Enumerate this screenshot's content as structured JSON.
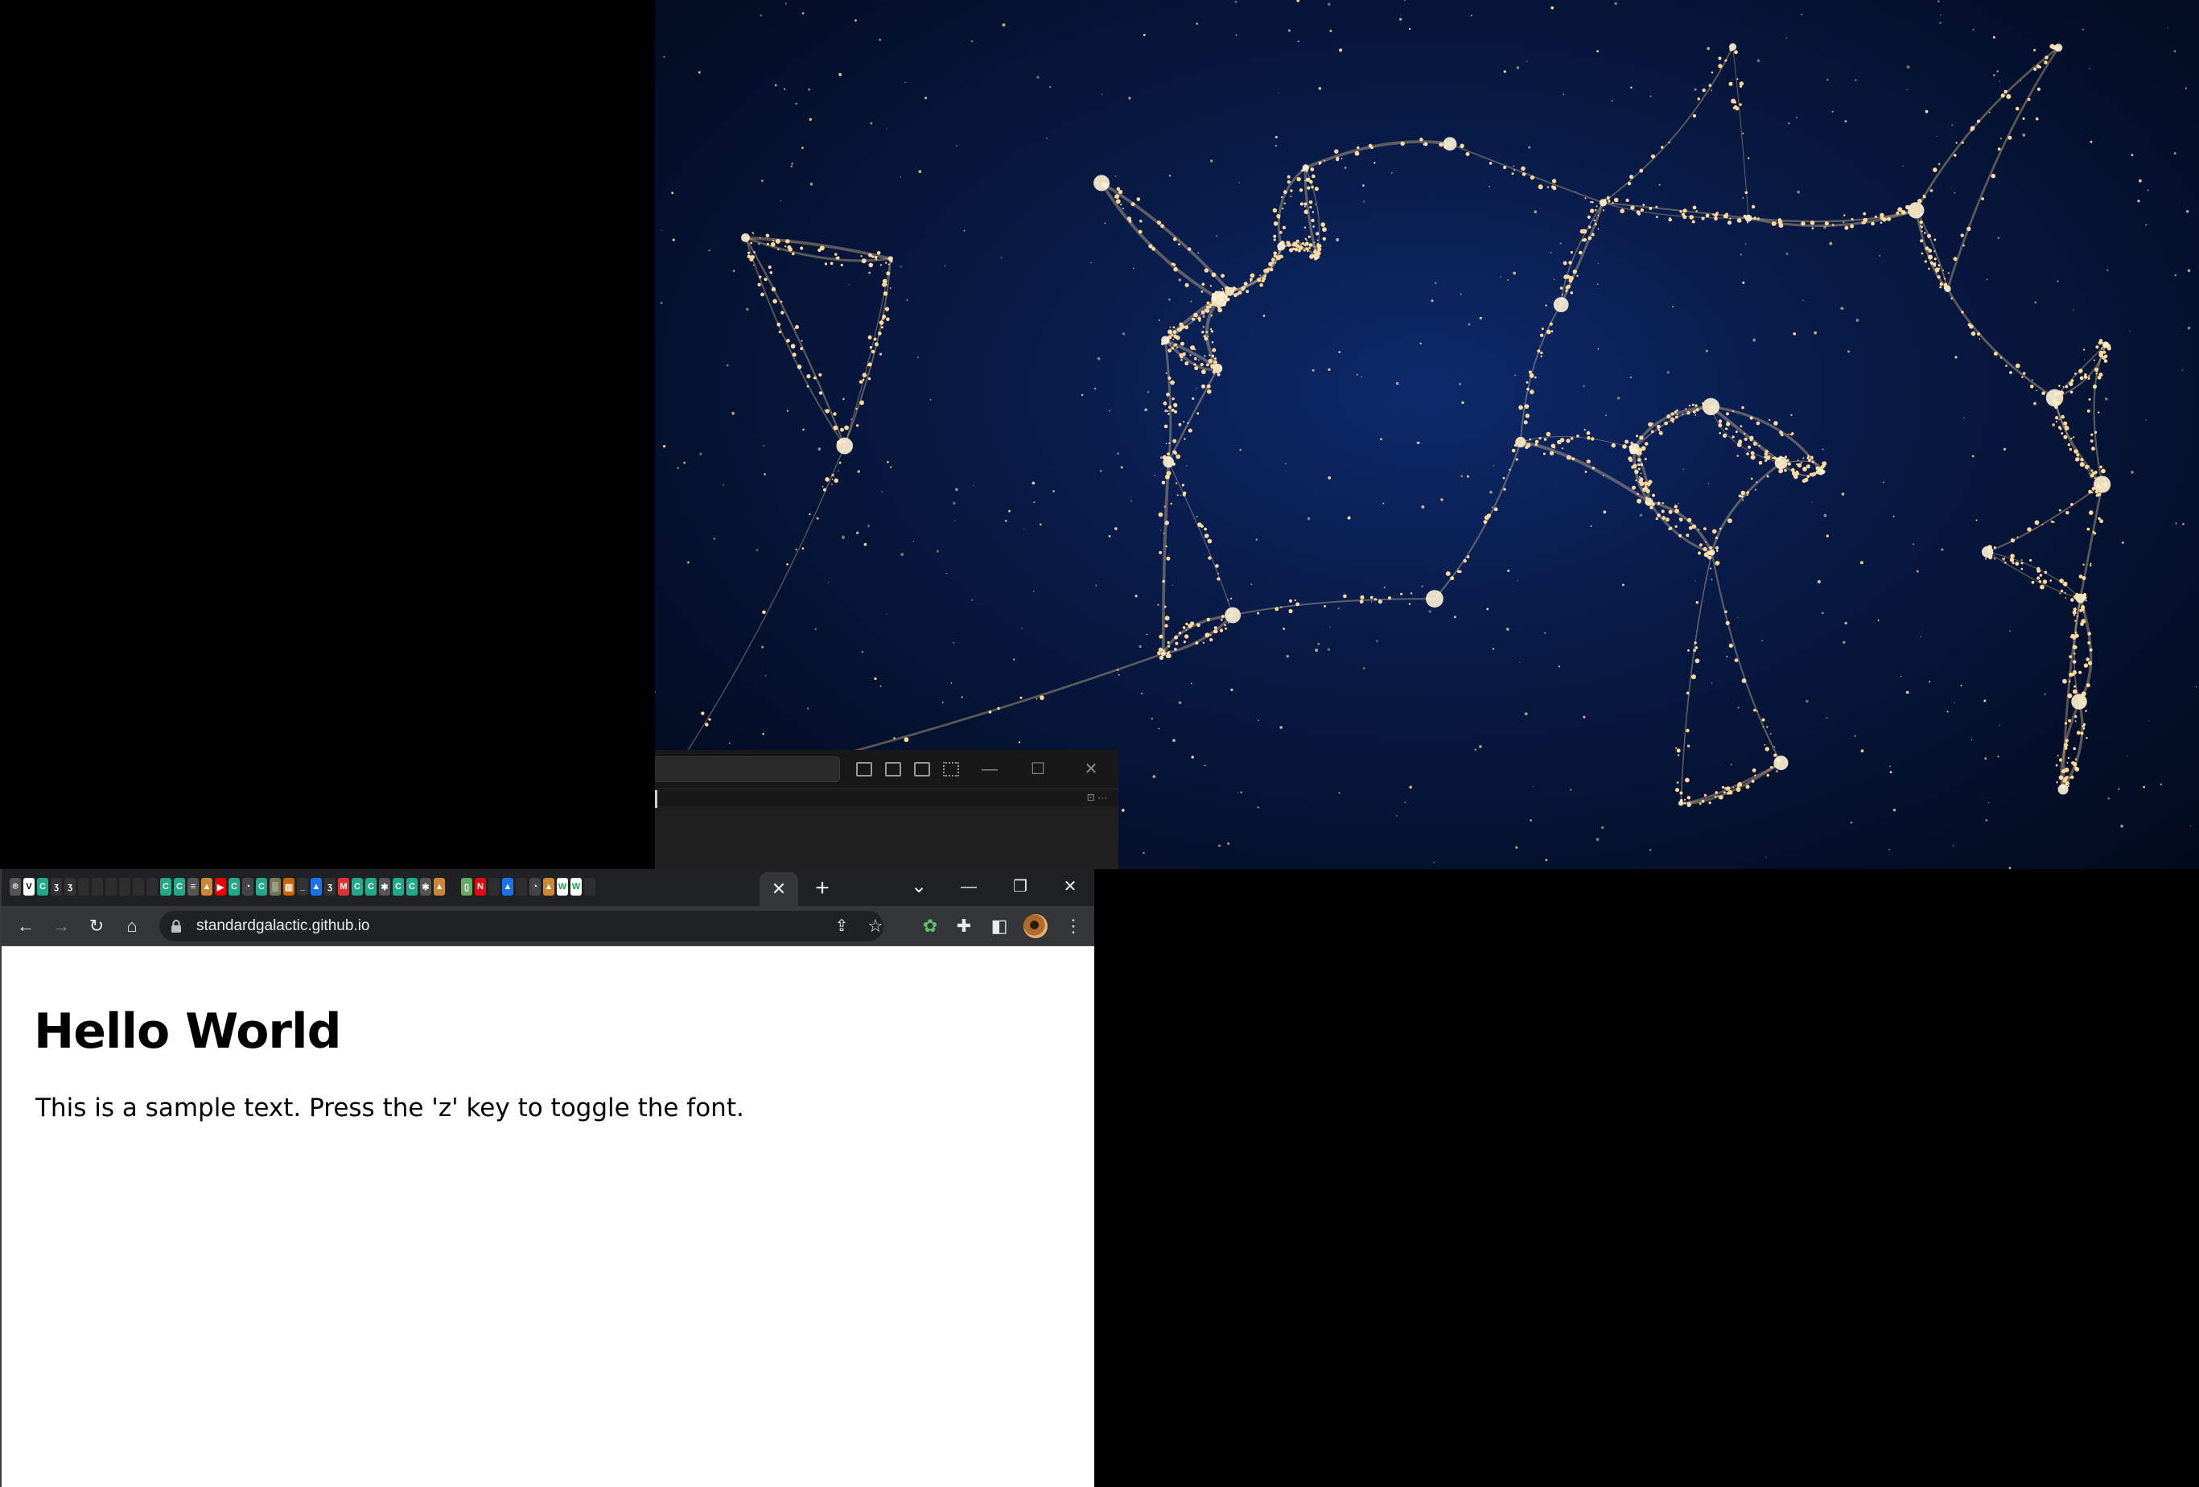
{
  "wallpaper": {
    "description_icon": "cosmic-web-wallpaper",
    "colors": {
      "void": "#04102c",
      "filament": "#ffd99a"
    }
  },
  "editor": {
    "layout_icons": [
      "toggle-primary-sidebar-icon",
      "toggle-panel-icon",
      "toggle-secondary-sidebar-icon",
      "customize-layout-icon"
    ],
    "window_controls": {
      "minimize": "—",
      "maximize": "☐",
      "close": "✕"
    },
    "mini_label": "⊡ ···"
  },
  "chrome": {
    "tabs": {
      "favicons": [
        {
          "glyph": "⌾",
          "bg": "#555"
        },
        {
          "glyph": "V",
          "bg": "#fff",
          "fg": "#000"
        },
        {
          "glyph": "C",
          "bg": "#2a8",
          "fg": "#fff"
        },
        {
          "glyph": "ʒ",
          "bg": "#333"
        },
        {
          "glyph": "ʒ",
          "bg": "#333"
        },
        {
          "glyph": "",
          "bg": "#2e2e2e"
        },
        {
          "glyph": "",
          "bg": "#2e2e2e"
        },
        {
          "glyph": "",
          "bg": "#2e2e2e"
        },
        {
          "glyph": "",
          "bg": "#2e2e2e"
        },
        {
          "glyph": "",
          "bg": "#2e2e2e"
        },
        {
          "glyph": "",
          "bg": "#2e2e2e"
        },
        {
          "glyph": "C",
          "bg": "#2a8"
        },
        {
          "glyph": "C",
          "bg": "#2a8"
        },
        {
          "glyph": "≡",
          "bg": "#555"
        },
        {
          "glyph": "▲",
          "bg": "#c83"
        },
        {
          "glyph": "▶",
          "bg": "#e00"
        },
        {
          "glyph": "C",
          "bg": "#2a8"
        },
        {
          "glyph": "◔",
          "bg": "#444"
        },
        {
          "glyph": "C",
          "bg": "#2a8"
        },
        {
          "glyph": "▒",
          "bg": "#775"
        },
        {
          "glyph": "▥",
          "bg": "#c60"
        },
        {
          "glyph": "_",
          "bg": "#333"
        },
        {
          "glyph": "▲",
          "bg": "#1a73e8"
        },
        {
          "glyph": "ʒ",
          "bg": "#333"
        },
        {
          "glyph": "M",
          "bg": "#d33"
        },
        {
          "glyph": "C",
          "bg": "#2a8"
        },
        {
          "glyph": "C",
          "bg": "#2a8"
        },
        {
          "glyph": "✱",
          "bg": "#555"
        },
        {
          "glyph": "C",
          "bg": "#2a8"
        },
        {
          "glyph": "C",
          "bg": "#2a8"
        },
        {
          "glyph": "✱",
          "bg": "#555"
        },
        {
          "glyph": "▲",
          "bg": "#c83"
        },
        {
          "glyph": "",
          "bg": "#202124"
        },
        {
          "glyph": "▯",
          "bg": "#6a6"
        },
        {
          "glyph": "N",
          "bg": "#e50914"
        },
        {
          "glyph": "",
          "bg": "#2e2e2e"
        },
        {
          "glyph": "▲",
          "bg": "#1a73e8"
        },
        {
          "glyph": "",
          "bg": "#2e2e2e"
        },
        {
          "glyph": "◔",
          "bg": "#444"
        },
        {
          "glyph": "▲",
          "bg": "#c83"
        },
        {
          "glyph": "W",
          "bg": "#fff",
          "fg": "#1a4"
        },
        {
          "glyph": "W",
          "bg": "#fff",
          "fg": "#1a4"
        },
        {
          "glyph": "",
          "bg": "#2e2e2e"
        }
      ],
      "active_tab_close": "✕",
      "new_tab": "+",
      "tab_search": "⌄"
    },
    "window_controls": {
      "minimize": "—",
      "restore": "❐",
      "close": "✕"
    },
    "toolbar": {
      "back": "←",
      "forward": "→",
      "reload": "↻",
      "home": "⌂",
      "url": "standardgalactic.github.io",
      "share": "⇪",
      "bookmark": "☆",
      "extension": "✿",
      "extensions_menu": "✚",
      "side_panel": "◧",
      "menu": "⋮"
    }
  },
  "page": {
    "heading": "Hello World",
    "paragraph": "This is a sample text. Press the 'z' key to toggle the font."
  }
}
